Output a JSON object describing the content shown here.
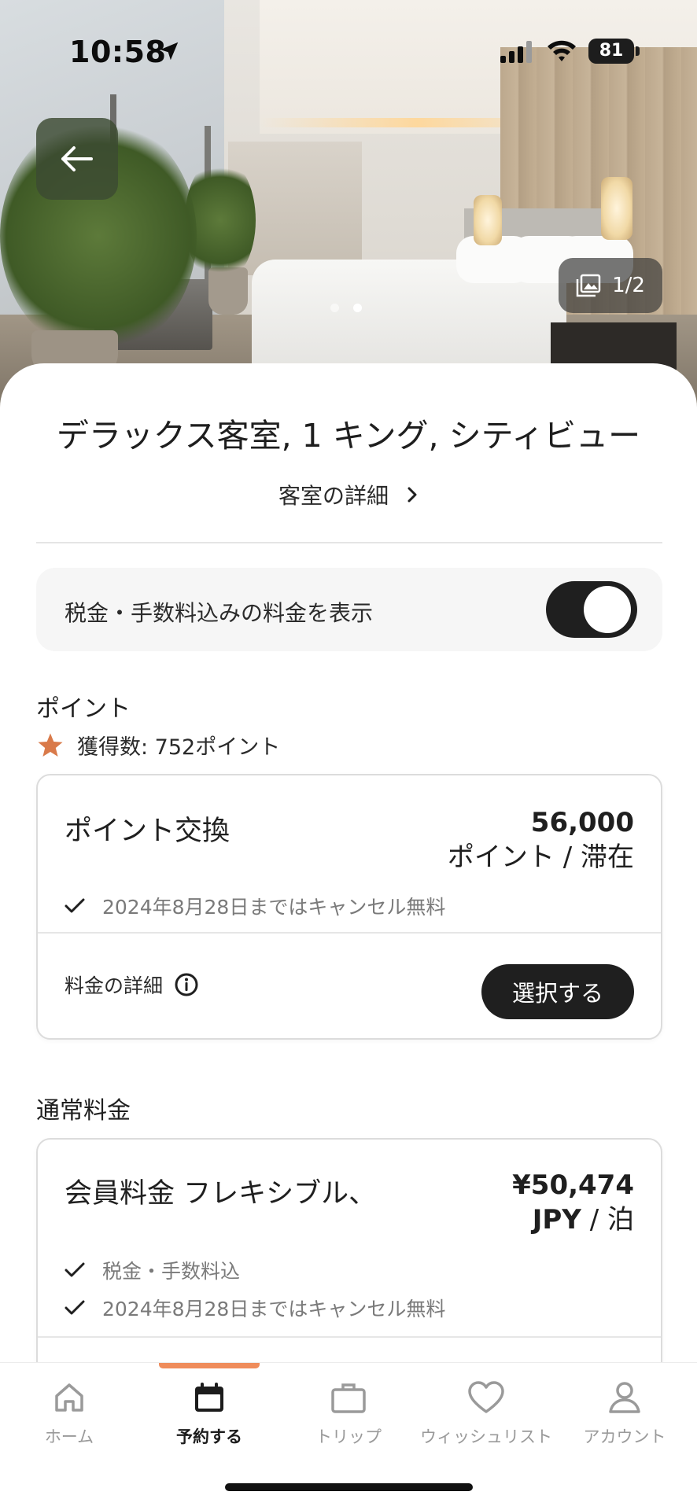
{
  "status_bar": {
    "time": "10:58",
    "battery": "81"
  },
  "hero": {
    "gallery_counter": "1/2"
  },
  "room": {
    "title": "デラックス客室, 1 キング, シティビュー",
    "details_link": "客室の詳細"
  },
  "tax_toggle": {
    "label": "税金・手数料込みの料金を表示",
    "enabled": true
  },
  "points_section": {
    "heading": "ポイント",
    "earn_text": "獲得数: 752ポイント",
    "card": {
      "title": "ポイント交換",
      "amount": "56,000",
      "unit": "ポイント / 滞在",
      "cancel_note": "2024年8月28日まではキャンセル無料",
      "fee_details": "料金の詳細",
      "select_label": "選択する"
    }
  },
  "regular_section": {
    "heading": "通常料金",
    "card": {
      "title": "会員料金 フレキシブル、",
      "amount": "¥50,474",
      "currency": "JPY",
      "per": " / 泊",
      "note_tax": "税金・手数料込",
      "cancel_note": "2024年8月28日まではキャンセル無料"
    }
  },
  "tabbar": {
    "active": "予約する",
    "items": [
      {
        "label": "ホーム",
        "icon": "home-icon"
      },
      {
        "label": "予約する",
        "icon": "calendar-icon"
      },
      {
        "label": "トリップ",
        "icon": "briefcase-icon"
      },
      {
        "label": "ウィッシュリスト",
        "icon": "heart-icon"
      },
      {
        "label": "アカウント",
        "icon": "person-icon"
      }
    ]
  },
  "colors": {
    "accent": "#ef8c5b",
    "dark": "#1f1f1f",
    "star": "#d97a4a"
  }
}
